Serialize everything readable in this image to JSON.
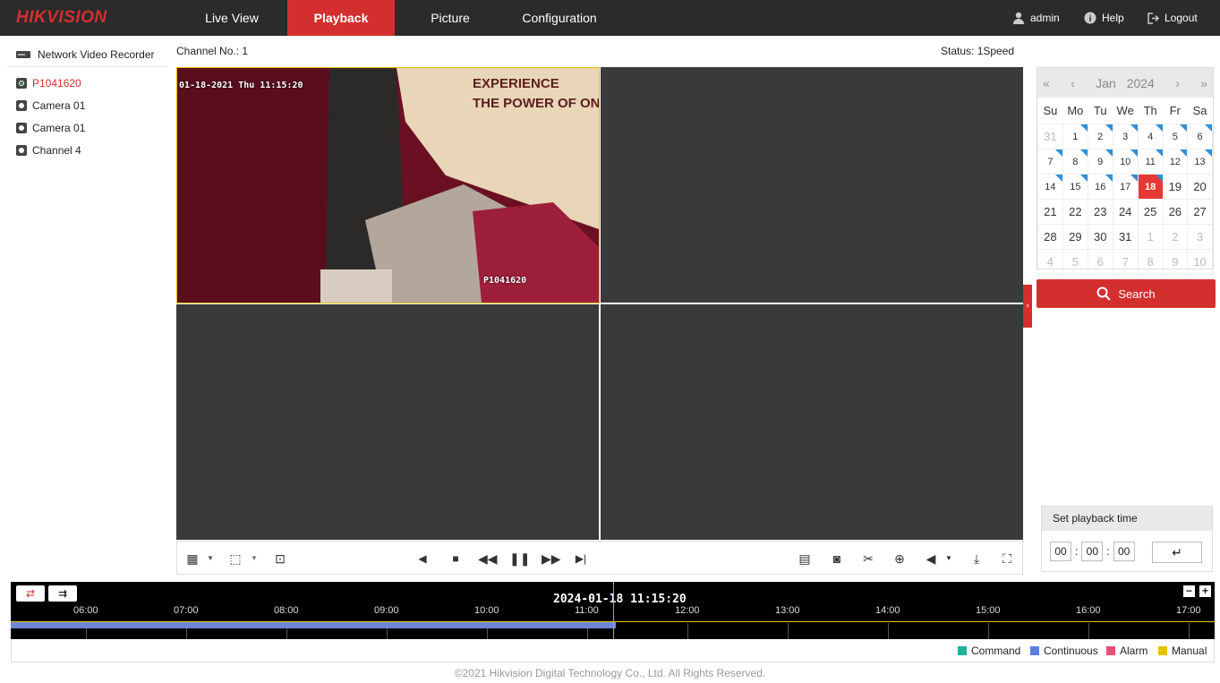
{
  "nav": {
    "logo": "HIKVISION",
    "tabs": [
      "Live View",
      "Playback",
      "Picture",
      "Configuration"
    ],
    "active_tab": "Playback",
    "user": "admin",
    "help": "Help",
    "logout": "Logout"
  },
  "sidebar": {
    "device": "Network Video Recorder",
    "channels": [
      "P1041620",
      "Camera 01",
      "Camera 01",
      "Channel 4"
    ],
    "active_channel": "P1041620"
  },
  "header": {
    "channel_no": "Channel No.: 1",
    "status": "Status: 1Speed"
  },
  "video": {
    "osd_time": "01-18-2021 Thu 11:15:20",
    "osd_name": "P1041620"
  },
  "calendar": {
    "month": "Jan",
    "year": "2024",
    "weekdays": [
      "Su",
      "Mo",
      "Tu",
      "We",
      "Th",
      "Fr",
      "Sa"
    ],
    "weeks": [
      [
        "31",
        "1",
        "2",
        "3",
        "4",
        "5",
        "6"
      ],
      [
        "7",
        "8",
        "9",
        "10",
        "11",
        "12",
        "13"
      ],
      [
        "14",
        "15",
        "16",
        "17",
        "18",
        "19",
        "20"
      ],
      [
        "21",
        "22",
        "23",
        "24",
        "25",
        "26",
        "27"
      ],
      [
        "28",
        "29",
        "30",
        "31",
        "1",
        "2",
        "3"
      ],
      [
        "4",
        "5",
        "6",
        "7",
        "8",
        "9",
        "10"
      ]
    ],
    "selected_day": "18",
    "record_days": [
      "1",
      "2",
      "3",
      "4",
      "5",
      "6",
      "7",
      "8",
      "9",
      "10",
      "11",
      "12",
      "13",
      "14",
      "15",
      "16",
      "17",
      "18"
    ],
    "search_label": "Search"
  },
  "playback_time": {
    "title": "Set playback time",
    "hh": "00",
    "mm": "00",
    "ss": "00"
  },
  "timeline": {
    "current": "2024-01-18 11:15:20",
    "ticks": [
      "06:00",
      "07:00",
      "08:00",
      "09:00",
      "10:00",
      "11:00",
      "12:00",
      "13:00",
      "14:00",
      "15:00",
      "16:00",
      "17:00"
    ],
    "legend": [
      {
        "label": "Command",
        "color": "#1db39a"
      },
      {
        "label": "Continuous",
        "color": "#5b7fe0"
      },
      {
        "label": "Alarm",
        "color": "#e84e7a"
      },
      {
        "label": "Manual",
        "color": "#e6c200"
      }
    ]
  },
  "footer": "©2021 Hikvision Digital Technology Co., Ltd. All Rights Reserved."
}
